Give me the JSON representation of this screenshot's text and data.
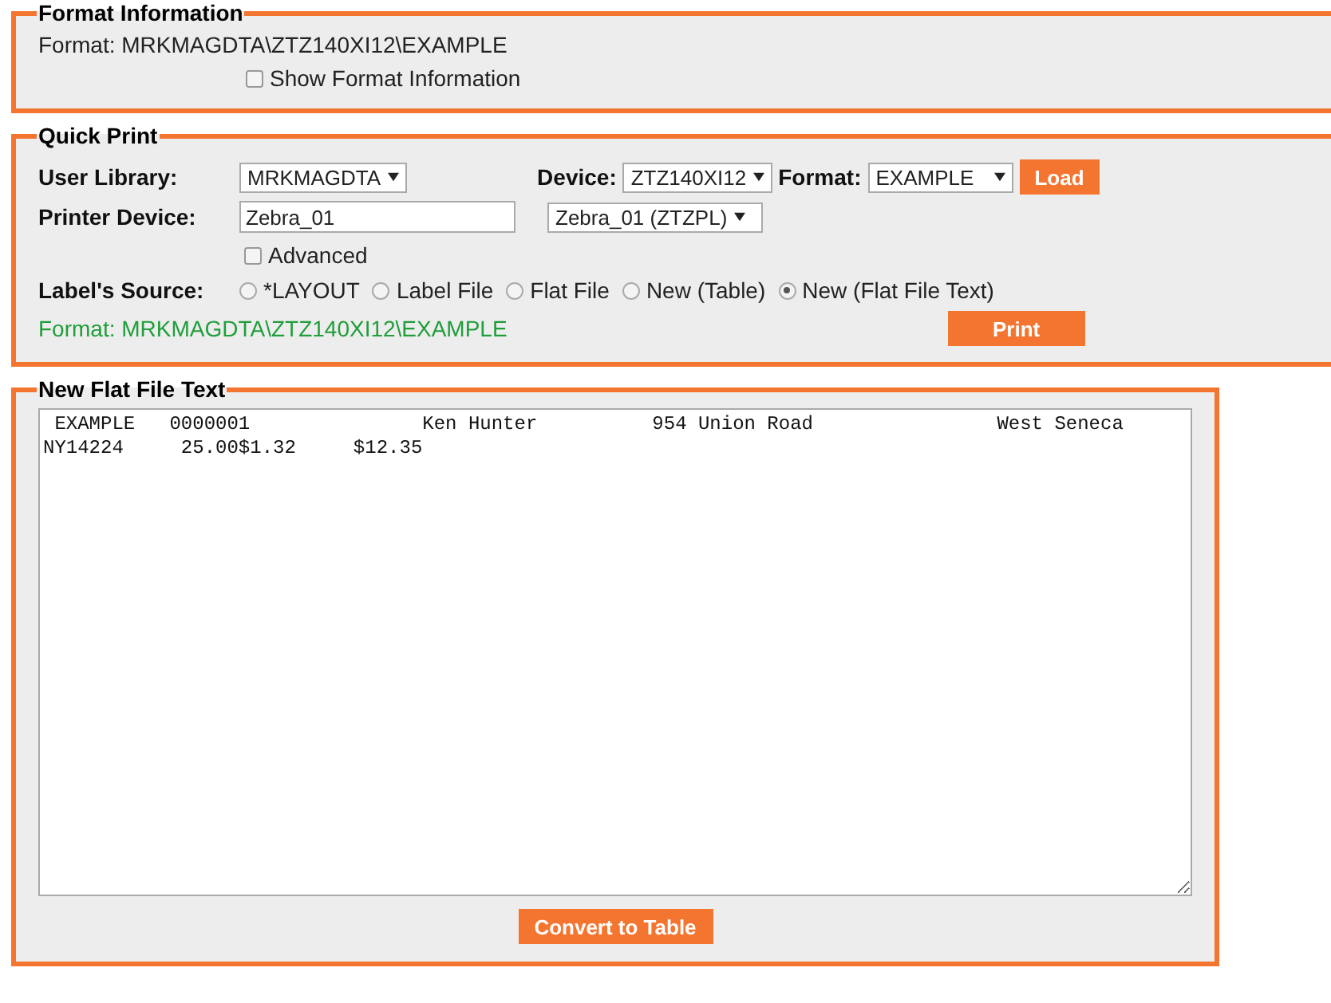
{
  "format_information": {
    "legend": "Format Information",
    "format_label": "Format:",
    "format_value": "MRKMAGDTA\\ZTZ140XI12\\EXAMPLE",
    "show_format_information": {
      "label": "Show Format Information",
      "checked": false
    }
  },
  "quick_print": {
    "legend": "Quick Print",
    "user_library": {
      "label": "User Library:",
      "value": "MRKMAGDTA"
    },
    "device": {
      "label": "Device:",
      "value": "ZTZ140XI12"
    },
    "format": {
      "label": "Format:",
      "value": "EXAMPLE"
    },
    "load_button": "Load",
    "printer_device": {
      "label": "Printer Device:",
      "value": "Zebra_01",
      "select_value": "Zebra_01 (ZTZPL)"
    },
    "advanced": {
      "label": "Advanced",
      "checked": false
    },
    "labels_source": {
      "label": "Label's Source:",
      "options": [
        {
          "label": "*LAYOUT",
          "selected": false
        },
        {
          "label": "Label File",
          "selected": false
        },
        {
          "label": "Flat File",
          "selected": false
        },
        {
          "label": "New (Table)",
          "selected": false
        },
        {
          "label": "New (Flat File Text)",
          "selected": true
        }
      ]
    },
    "status": "Format: MRKMAGDTA\\ZTZ140XI12\\EXAMPLE",
    "print_button": "Print"
  },
  "new_flat_file_text": {
    "legend": "New Flat File Text",
    "lines": [
      " EXAMPLE   0000001               Ken Hunter          954 Union Road                West Seneca",
      "NY14224     25.00$1.32     $12.35"
    ],
    "convert_button": "Convert to Table"
  }
}
